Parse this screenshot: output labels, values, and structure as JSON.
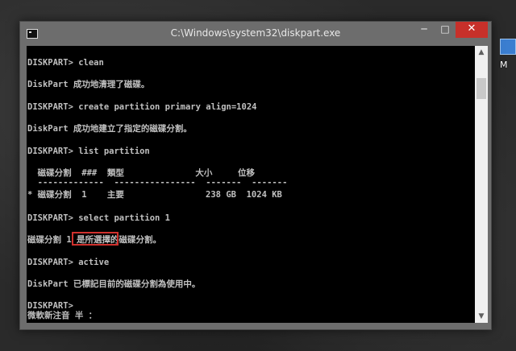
{
  "window": {
    "title": "C:\\Windows\\system32\\diskpart.exe",
    "minimize_glyph": "─",
    "maximize_glyph": "□",
    "close_glyph": "✕"
  },
  "desktop": {
    "icon_label": "M"
  },
  "console": {
    "lines": [
      "DISKPART> clean",
      "DiskPart 成功地清理了磁碟。",
      "DISKPART> create partition primary align=1024",
      "DiskPart 成功地建立了指定的磁碟分割。",
      "DISKPART> list partition",
      "  磁碟分割  ###  類型              大小     位移",
      "  -------------  ----------------  -------  -------",
      "* 磁碟分割  1    主要                238 GB  1024 KB",
      "DISKPART> select partition 1",
      "磁碟分割 1 是所選擇的磁碟分割。",
      "DISKPART> active",
      "DiskPart 已標記目前的磁碟分割為使用中。",
      "DISKPART>",
      "微軟新注音 半 ："
    ]
  },
  "colors": {
    "console_bg": "#000000",
    "console_text": "#c0c0c0",
    "close_button": "#c7302a",
    "highlight_box": "#d0312d"
  },
  "scrollbar": {
    "up_glyph": "▲",
    "down_glyph": "▼"
  }
}
